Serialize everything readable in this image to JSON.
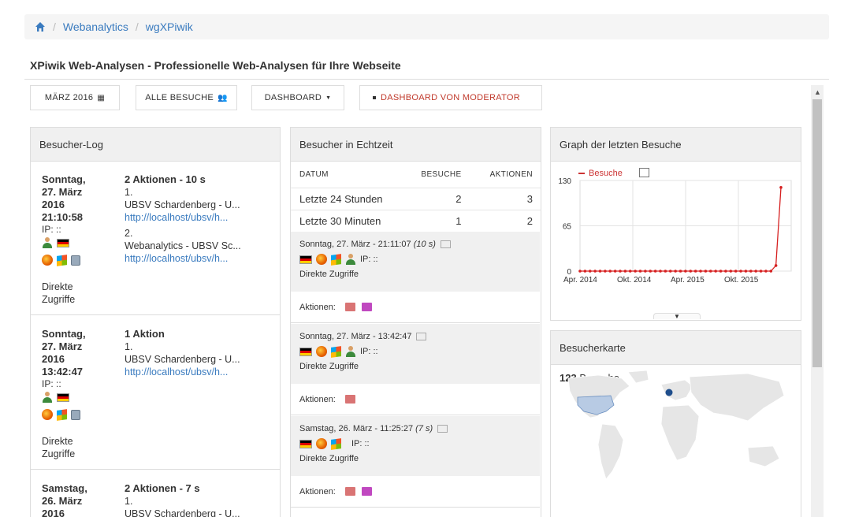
{
  "breadcrumb": {
    "items": [
      "Webanalytics",
      "wgXPiwik"
    ]
  },
  "page_title": "XPiwik Web-Analysen - Professionelle Web-Analysen für Ihre Webseite",
  "toolbar": {
    "period_label": "MÄRZ 2016",
    "visits_label": "ALLE BESUCHE",
    "dashboard_label": "DASHBOARD",
    "moderator_label": "DASHBOARD VON MODERATOR"
  },
  "log": {
    "title": "Besucher-Log",
    "entries": [
      {
        "date_lines": [
          "Sonntag,",
          "27. März",
          "2016",
          "21:10:58"
        ],
        "ip": "IP: ::",
        "header": "2 Aktionen - 10 s",
        "actions": [
          {
            "num": "1.",
            "title": "UBSV Schardenberg - U...",
            "url": "http://localhost/ubsv/h..."
          },
          {
            "num": "2.",
            "title": "Webanalytics - UBSV Sc...",
            "url": "http://localhost/ubsv/h..."
          }
        ],
        "referrer_lines": [
          "Direkte",
          "Zugriffe"
        ]
      },
      {
        "date_lines": [
          "Sonntag,",
          "27. März",
          "2016",
          "13:42:47"
        ],
        "ip": "IP: ::",
        "header": "1 Aktion",
        "actions": [
          {
            "num": "1.",
            "title": "UBSV Schardenberg - U...",
            "url": "http://localhost/ubsv/h..."
          }
        ],
        "referrer_lines": [
          "Direkte",
          "Zugriffe"
        ]
      },
      {
        "date_lines": [
          "Samstag,",
          "26. März",
          "2016"
        ],
        "header": "2 Aktionen - 7 s",
        "actions": [
          {
            "num": "1.",
            "title": "UBSV Schardenberg - U..."
          }
        ]
      }
    ]
  },
  "realtime": {
    "title": "Besucher in Echtzeit",
    "columns": [
      "DATUM",
      "BESUCHE",
      "AKTIONEN"
    ],
    "rows": [
      {
        "label": "Letzte 24 Stunden",
        "visits": "2",
        "actions": "3"
      },
      {
        "label": "Letzte 30 Minuten",
        "visits": "1",
        "actions": "2"
      }
    ],
    "visits": [
      {
        "time": "Sonntag, 27. März - 21:11:07",
        "duration": "(10 s)",
        "ip": "IP: ::",
        "referrer": "Direkte Zugriffe",
        "actions_label": "Aktionen:"
      },
      {
        "time": "Sonntag, 27. März - 13:42:47",
        "duration": "",
        "ip": "IP: ::",
        "referrer": "Direkte Zugriffe",
        "actions_label": "Aktionen:"
      },
      {
        "time": "Samstag, 26. März - 11:25:27",
        "duration": "(7 s)",
        "ip": "IP: ::",
        "referrer": "Direkte Zugriffe",
        "actions_label": "Aktionen:"
      }
    ]
  },
  "graph": {
    "title": "Graph der letzten Besuche",
    "legend": "Besuche",
    "accent": "#d62020"
  },
  "map": {
    "title": "Besucherkarte",
    "count": "123",
    "count_label": "Besuche"
  },
  "chart_data": {
    "type": "line",
    "series": [
      {
        "name": "Besuche",
        "values": [
          0,
          0,
          0,
          0,
          0,
          0,
          0,
          0,
          0,
          0,
          0,
          0,
          0,
          0,
          0,
          0,
          0,
          0,
          0,
          0,
          0,
          0,
          0,
          0,
          0,
          0,
          0,
          0,
          0,
          0,
          0,
          0,
          0,
          0,
          0,
          0,
          0,
          0,
          0,
          8,
          120
        ]
      }
    ],
    "ylim": [
      0,
      130
    ],
    "yticks": [
      "0",
      "65",
      "130"
    ],
    "xticks": [
      "Apr. 2014",
      "Okt. 2014",
      "Apr. 2015",
      "Okt. 2015"
    ],
    "grid": true
  }
}
